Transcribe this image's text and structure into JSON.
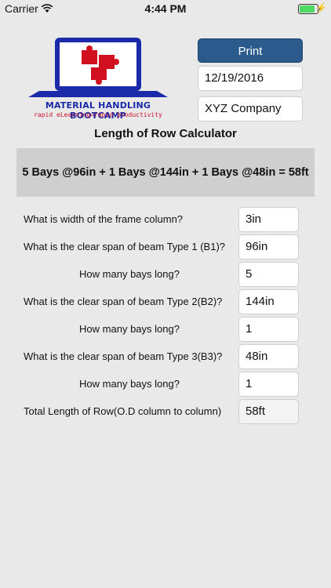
{
  "status": {
    "carrier": "Carrier",
    "time": "4:44 PM"
  },
  "logo": {
    "title": "MATERIAL HANDLING BOOTCAMP",
    "subtitle": "rapid eLearning=rapid productivity",
    "colors": {
      "frame": "#1a2aa8",
      "puzzle": "#d0101e"
    }
  },
  "header": {
    "print_label": "Print",
    "date": "12/19/2016",
    "company": "XYZ Company"
  },
  "title": "Length of Row Calculator",
  "result": "5 Bays @96in + 1 Bays @144in + 1 Bays @48in = 58ft",
  "rows": [
    {
      "label": "What is width of the frame column?",
      "value": "3in"
    },
    {
      "label": "What is the clear span of beam Type 1 (B1)?",
      "value": "96in"
    },
    {
      "label": "How many bays long?",
      "value": "5"
    },
    {
      "label": "What is the clear span of beam Type 2(B2)?",
      "value": "144in"
    },
    {
      "label": "How many bays long?",
      "value": "1"
    },
    {
      "label": "What is the clear span of beam Type 3(B3)?",
      "value": "48in"
    },
    {
      "label": "How many bays long?",
      "value": "1"
    },
    {
      "label": "Total Length of Row(O.D column to column)",
      "value": "58ft"
    }
  ]
}
